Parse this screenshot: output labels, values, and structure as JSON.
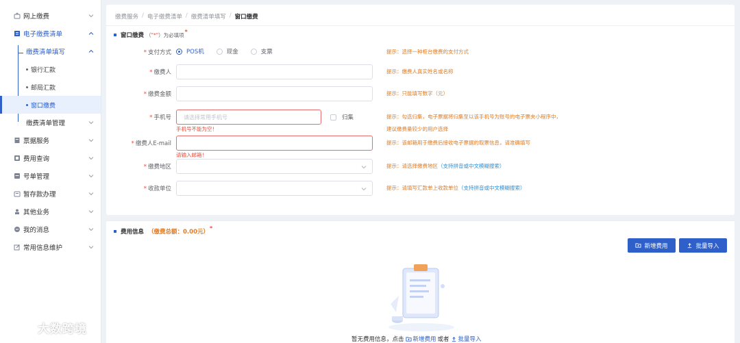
{
  "sidebar": {
    "items": [
      {
        "label": "网上缴费"
      },
      {
        "label": "电子缴费清单"
      },
      {
        "label": "缴费清单填写"
      },
      {
        "label": "银行汇款"
      },
      {
        "label": "邮局汇款"
      },
      {
        "label": "窗口缴费"
      },
      {
        "label": "缴费清单管理"
      },
      {
        "label": "票据服务"
      },
      {
        "label": "费用查询"
      },
      {
        "label": "号单管理"
      },
      {
        "label": "暂存款办理"
      },
      {
        "label": "其他业务"
      },
      {
        "label": "我的消息"
      },
      {
        "label": "常用信息维护"
      }
    ]
  },
  "breadcrumb": [
    "缴费服务",
    "电子缴费清单",
    "缴费清单填写",
    "窗口缴费"
  ],
  "breadcrumb_sep": "/",
  "form": {
    "title": "窗口缴费",
    "required_note_prefix": "（",
    "required_note_star": "\"*\"",
    "required_note_suffix": "）为必填项",
    "title_star": "*",
    "payment_method": {
      "label": "支付方式",
      "options": [
        "POS机",
        "现金",
        "支票"
      ],
      "selected": "POS机",
      "tip": "提示：选择一种柜台缴费的支付方式"
    },
    "payer": {
      "label": "缴费人",
      "tip": "提示：缴费人真实姓名或名称"
    },
    "amount": {
      "label": "缴费金额",
      "tip": "提示：只能填写数字（元）"
    },
    "phone": {
      "label": "手机号",
      "placeholder": "请选择常用手机号",
      "error": "手机号不能为空！",
      "checkbox_label": "归集",
      "tip1": "提示：勾选归集，电子票据将归集至以该手机号为账号的电子票夹小程序中，",
      "tip2": "建议缴费量较少的用户选择"
    },
    "email": {
      "label": "缴费人E-mail",
      "error": "请输入邮箱！",
      "tip": "提示：该邮箱用于缴费后接收电子票据的取票信息，请准确填写"
    },
    "region": {
      "label": "缴费地区",
      "tip_prefix": "提示：请选择缴费地区",
      "tip_blue": "（支持拼音或中文模糊搜索）"
    },
    "receiver": {
      "label": "收款单位",
      "tip_prefix": "提示：请填写汇款单上收款单位",
      "tip_blue": "（支持拼音或中文模糊搜索）"
    },
    "req_mark": "*"
  },
  "fees": {
    "title": "费用信息",
    "total": "（缴费总额：0.00元）",
    "star": "*",
    "add_button": "新增费用",
    "import_button": "批量导入",
    "empty_prefix": "暂无费用信息，点击",
    "empty_add": "新增费用",
    "empty_or": "或者",
    "empty_import": "批量导入"
  },
  "watermark": "大数跨境",
  "colors": {
    "primary": "#2f5fc9",
    "tip": "#e07b22",
    "error": "#e74c3c",
    "tip_blue": "#2f8fd6"
  }
}
